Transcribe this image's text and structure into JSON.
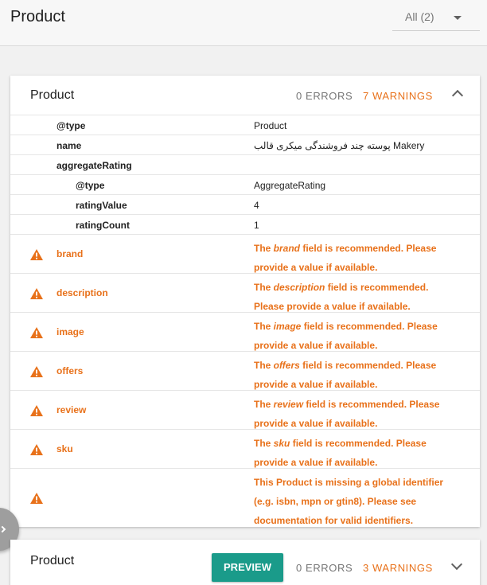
{
  "header": {
    "title": "Product",
    "filter_label": "All (2)"
  },
  "card1": {
    "title": "Product",
    "errors": "0 ERRORS",
    "warnings": "7 WARNINGS",
    "properties": [
      {
        "key": "@type",
        "value": "Product"
      },
      {
        "key": "name",
        "value": "پوسته چند فروشندگی میکری قالب Makery"
      },
      {
        "key": "aggregateRating",
        "value": ""
      },
      {
        "key": "@type",
        "value": "AggregateRating"
      },
      {
        "key": "ratingValue",
        "value": "4"
      },
      {
        "key": "ratingCount",
        "value": "1"
      }
    ],
    "warnings_list": [
      {
        "key": "brand",
        "pre": "The ",
        "field": "brand",
        "post": " field is recommended. Please provide a value if available."
      },
      {
        "key": "description",
        "pre": "The ",
        "field": "description",
        "post": " field is recommended. Please provide a value if available."
      },
      {
        "key": "image",
        "pre": "The ",
        "field": "image",
        "post": " field is recommended. Please provide a value if available."
      },
      {
        "key": "offers",
        "pre": "The ",
        "field": "offers",
        "post": " field is recommended. Please provide a value if available."
      },
      {
        "key": "review",
        "pre": "The ",
        "field": "review",
        "post": " field is recommended. Please provide a value if available."
      },
      {
        "key": "sku",
        "pre": "The ",
        "field": "sku",
        "post": " field is recommended. Please provide a value if available."
      }
    ],
    "identifier_warning": "This Product is missing a global identifier (e.g. isbn, mpn or gtin8). Please see documentation for valid identifiers."
  },
  "card2": {
    "title": "Product",
    "preview_label": "PREVIEW",
    "errors": "0 ERRORS",
    "warnings": "3 WARNINGS"
  },
  "colors": {
    "warning": "#e8711a",
    "preview": "#1a9b8a"
  },
  "icons": {
    "filter": "dropdown-caret-icon",
    "collapse": "chevron-up-icon",
    "expand": "chevron-down-icon",
    "warning": "warning-triangle-icon"
  }
}
